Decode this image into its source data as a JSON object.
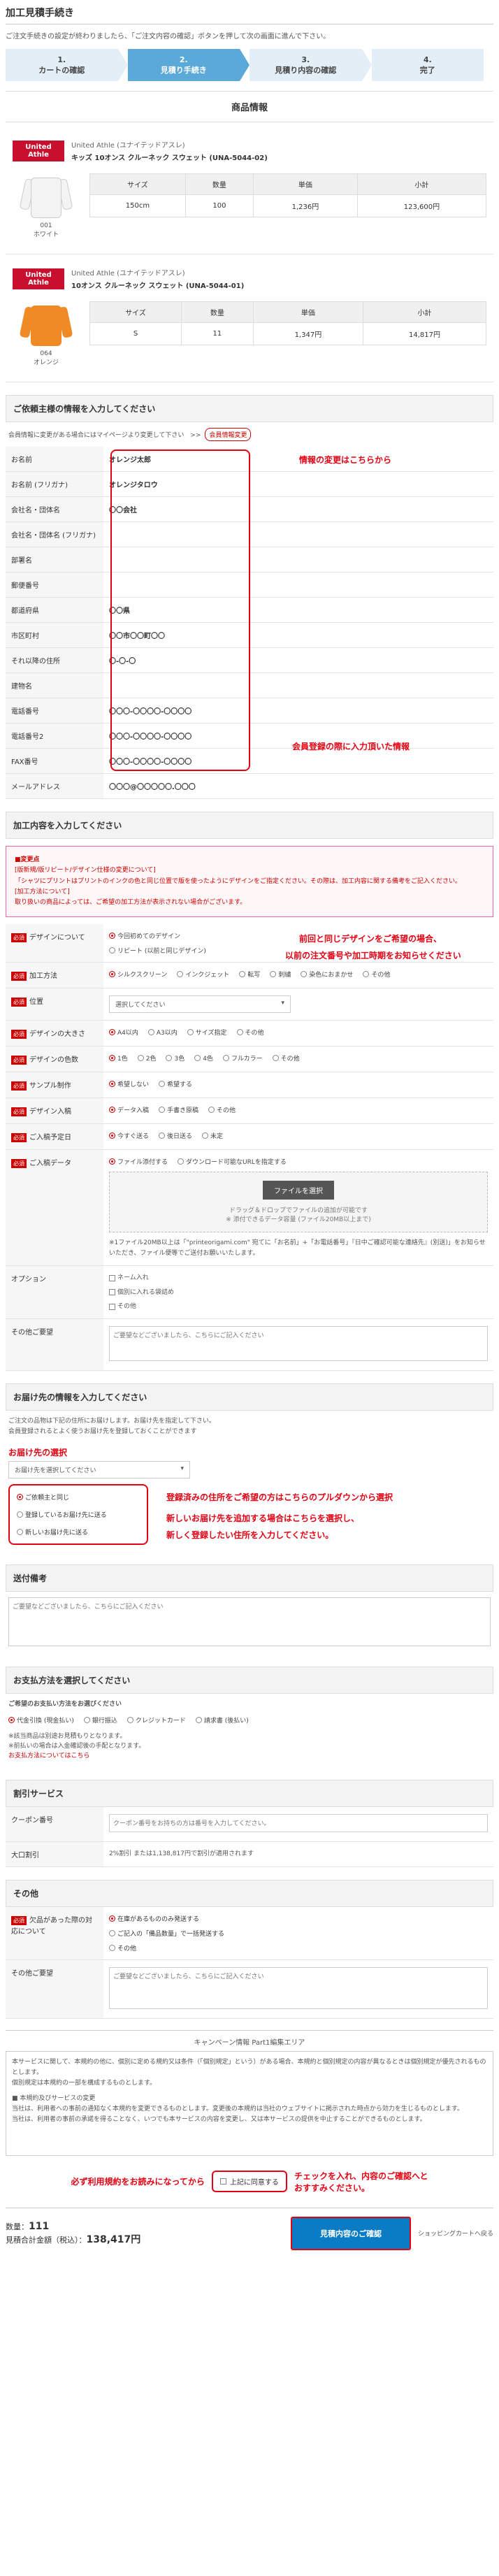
{
  "page": {
    "title": "加工見積手続き",
    "lead": "ご注文手続きの設定が終わりましたら、「ご注文内容の確認」ボタンを押して次の画面に進んで下さい。",
    "steps": [
      {
        "num": "1.",
        "label": "カートの確認"
      },
      {
        "num": "2.",
        "label": "見積り手続き"
      },
      {
        "num": "3.",
        "label": "見積り内容の確認"
      },
      {
        "num": "4.",
        "label": "完了"
      }
    ]
  },
  "products_section": {
    "title": "商品情報"
  },
  "products": [
    {
      "brand": "United Athle",
      "maker": "United Athle (ユナイテッドアスレ)",
      "name": "キッズ 10オンス クルーネック スウェット (UNA-5044-02)",
      "color_code": "001",
      "color_name": "ホワイト",
      "headers": [
        "サイズ",
        "数量",
        "単価",
        "小計"
      ],
      "row": [
        "150cm",
        "100",
        "1,236円",
        "123,600円"
      ]
    },
    {
      "brand": "United Athle",
      "maker": "United Athle (ユナイテッドアスレ)",
      "name": "10オンス クルーネック スウェット (UNA-5044-01)",
      "color_code": "064",
      "color_name": "オレンジ",
      "headers": [
        "サイズ",
        "数量",
        "単価",
        "小計"
      ],
      "row": [
        "S",
        "11",
        "1,347円",
        "14,817円"
      ]
    }
  ],
  "customer": {
    "title": "ご依頼主様の情報を入力してください",
    "note": "会員情報に変更がある場合にはマイページより変更して下さい　>>",
    "change_button": "会員情報変更",
    "fields": [
      {
        "label": "お名前",
        "value": "オレンジ太郎"
      },
      {
        "label": "お名前 (フリガナ)",
        "value": "オレンジタロウ"
      },
      {
        "label": "会社名・団体名",
        "value": "〇〇会社"
      },
      {
        "label": "会社名・団体名 (フリガナ)",
        "value": ""
      },
      {
        "label": "部署名",
        "value": ""
      },
      {
        "label": "郵便番号",
        "value": ""
      },
      {
        "label": "都道府県",
        "value": "〇〇県"
      },
      {
        "label": "市区町村",
        "value": "〇〇市〇〇町〇〇"
      },
      {
        "label": "それ以降の住所",
        "value": "〇-〇-〇"
      },
      {
        "label": "建物名",
        "value": ""
      },
      {
        "label": "電話番号",
        "value": "〇〇〇-〇〇〇〇-〇〇〇〇"
      },
      {
        "label": "電話番号2",
        "value": "〇〇〇-〇〇〇〇-〇〇〇〇"
      },
      {
        "label": "FAX番号",
        "value": "〇〇〇-〇〇〇〇-〇〇〇〇"
      },
      {
        "label": "メールアドレス",
        "value": "〇〇〇@〇〇〇〇〇.〇〇〇"
      }
    ],
    "annot_change": "情報の変更はこちらから",
    "annot_member": "会員登録の際に入力頂いた情報"
  },
  "processing": {
    "title": "加工内容を入力してください",
    "notice_title": "■変更点",
    "notice_lines": [
      "[版新規/版リピート/デザイン仕様の変更について]",
      "「シャツにプリントはプリントのインクの色と同じ位置で版を使ったようにデザインをご指定ください。その際は、加工内容に関する備考をご記入ください。",
      "[加工方法について]",
      "取り扱いの商品によっては、ご希望の加工方法が表示されない場合がございます。"
    ],
    "req_label": "必須",
    "rows": [
      {
        "label": "デザインについて",
        "required": true,
        "options": [
          "今回初めてのデザイン",
          "リピート (以前と同じデザイン)"
        ],
        "selected": 0
      },
      {
        "label": "加工方法",
        "required": true,
        "options": [
          "シルクスクリーン",
          "インクジェット",
          "転写",
          "刺繍",
          "染色におまかせ",
          "その他"
        ],
        "selected": 0
      },
      {
        "label": "位置",
        "required": true,
        "select": "選択してください"
      },
      {
        "label": "デザインの大きさ",
        "required": true,
        "options": [
          "A4以内",
          "A3以内",
          "サイズ指定",
          "その他"
        ],
        "selected": 0
      },
      {
        "label": "デザインの色数",
        "required": true,
        "options": [
          "1色",
          "2色",
          "3色",
          "4色",
          "フルカラー",
          "その他"
        ],
        "selected": 0
      },
      {
        "label": "サンプル制作",
        "required": true,
        "options": [
          "希望しない",
          "希望する"
        ],
        "selected": 0
      },
      {
        "label": "デザイン入稿",
        "required": true,
        "options": [
          "データ入稿",
          "手書き原稿",
          "その他"
        ],
        "selected": 0
      },
      {
        "label": "ご入稿予定日",
        "required": true,
        "options": [
          "今すぐ送る",
          "後日送る",
          "未定"
        ],
        "selected": 0
      },
      {
        "label": "ご入稿データ",
        "required": true,
        "options": [
          "ファイル添付する",
          "ダウンロード可能なURLを指定する"
        ],
        "selected": 0
      }
    ],
    "upload_button": "ファイルを選択",
    "upload_hint": "ドラッグ＆ドロップでファイルの追加が可能です",
    "upload_hint2": "※ 添付できるデータ容量 (ファイル20MB以上まで)",
    "upload_note": "※1ファイル20MB以上は「\"printeorigami.com\" 宛てに「お名前」+「お電話番号」『日中ご確認可能な連絡先』(別送)」をお知らせいただき、ファイル便等でご送付お願いいたします。",
    "option_label": "オプション",
    "option_items": [
      "ネーム入れ",
      "個別に入れる袋詰め",
      "その他"
    ],
    "memo_label": "その他ご要望",
    "memo_placeholder": "ご要望などございましたら、こちらにご記入ください",
    "annot_repeat1": "前回と同じデザインをご希望の場合、",
    "annot_repeat2": "以前の注文番号や加工時期をお知らせください"
  },
  "delivery": {
    "title": "お届け先の情報を入力してください",
    "note1": "ご注文の品物は下記の住所にお届けします。お届け先を指定して下さい。",
    "note2": "会員登録されるとよく使うお届け先を登録しておくことができます",
    "select_placeholder": "お届け先を選択してください",
    "options": [
      "ご依頼主と同じ",
      "登録しているお届け先に送る",
      "新しいお届け先に送る"
    ],
    "selected": 0,
    "annot_title": "お届け先の選択",
    "annot_line1": "登録済みの住所をご希望の方はこちらのプルダウンから選択",
    "annot_line2": "新しいお届け先を追加する場合はこちらを選択し、",
    "annot_line3": "新しく登録したい住所を入力してください。",
    "memo_title": "送付備考",
    "memo_placeholder": "ご要望などございましたら、こちらにご記入ください"
  },
  "payment": {
    "title": "お支払方法を選択してください",
    "subtitle": "ご希望のお支払い方法をお選びください",
    "options": [
      "代金引換 (現金払い)",
      "銀行振込",
      "クレジットカード",
      "請求書 (後払い)"
    ],
    "selected": 0,
    "note1": "※該当商品は別途お見積もりとなります。",
    "note2": "※前払いの場合は入金確認後の手配となります。",
    "note3": "お支払方法についてはこちら"
  },
  "discount": {
    "title": "割引サービス",
    "coupon_label": "クーポン番号",
    "coupon_placeholder": "クーポン番号をお持ちの方は番号を入力してください。",
    "large_label": "大口割引",
    "large_value": "2%割引 または1,138,817円で割引が適用されます"
  },
  "other": {
    "title": "その他",
    "faulty_label": "欠品があった際の対応について",
    "faulty_options": [
      "在庫があるもののみ発送する",
      "ご記入の「備品数量」で一括発送する",
      "その他"
    ],
    "faulty_selected": 0,
    "memo_label": "その他ご要望",
    "memo_placeholder": "ご要望などございましたら、こちらにご記入ください"
  },
  "campaign": {
    "title": "キャンペーン情報 Part1編集エリア",
    "lines": [
      "本サービスに関して、本規約の他に、個別に定める規約又は条件（「個別規定」という）がある場合、本規約と個別規定の内容が異なるときは個別規定が優先されるものとします。",
      "個別規定は本規約の一部を構成するものとします。",
      "■ 本規約及びサービスの変更",
      "当社は、利用者への事前の通知なく本規約を変更できるものとします。変更後の本規約は当社のウェブサイトに掲示された時点から効力を生じるものとします。",
      "当社は、利用者の事前の承諾を得ることなく、いつでも本サービスの内容を変更し、又は本サービスの提供を中止することができるものとします。"
    ]
  },
  "agree": {
    "label": "上記に同意する",
    "annot_left": "必ず利用規約をお読みになってから",
    "annot_right1": "チェックを入れ、内容のご確認へと",
    "annot_right2": "おすすみください。"
  },
  "footer": {
    "qty_label": "数量：",
    "qty_value": "111",
    "total_label": "見積合計金額（税込）：",
    "total_value": "138,417円",
    "confirm_button": "見積内容のご確認",
    "back_link": "ショッピングカートへ戻る"
  }
}
